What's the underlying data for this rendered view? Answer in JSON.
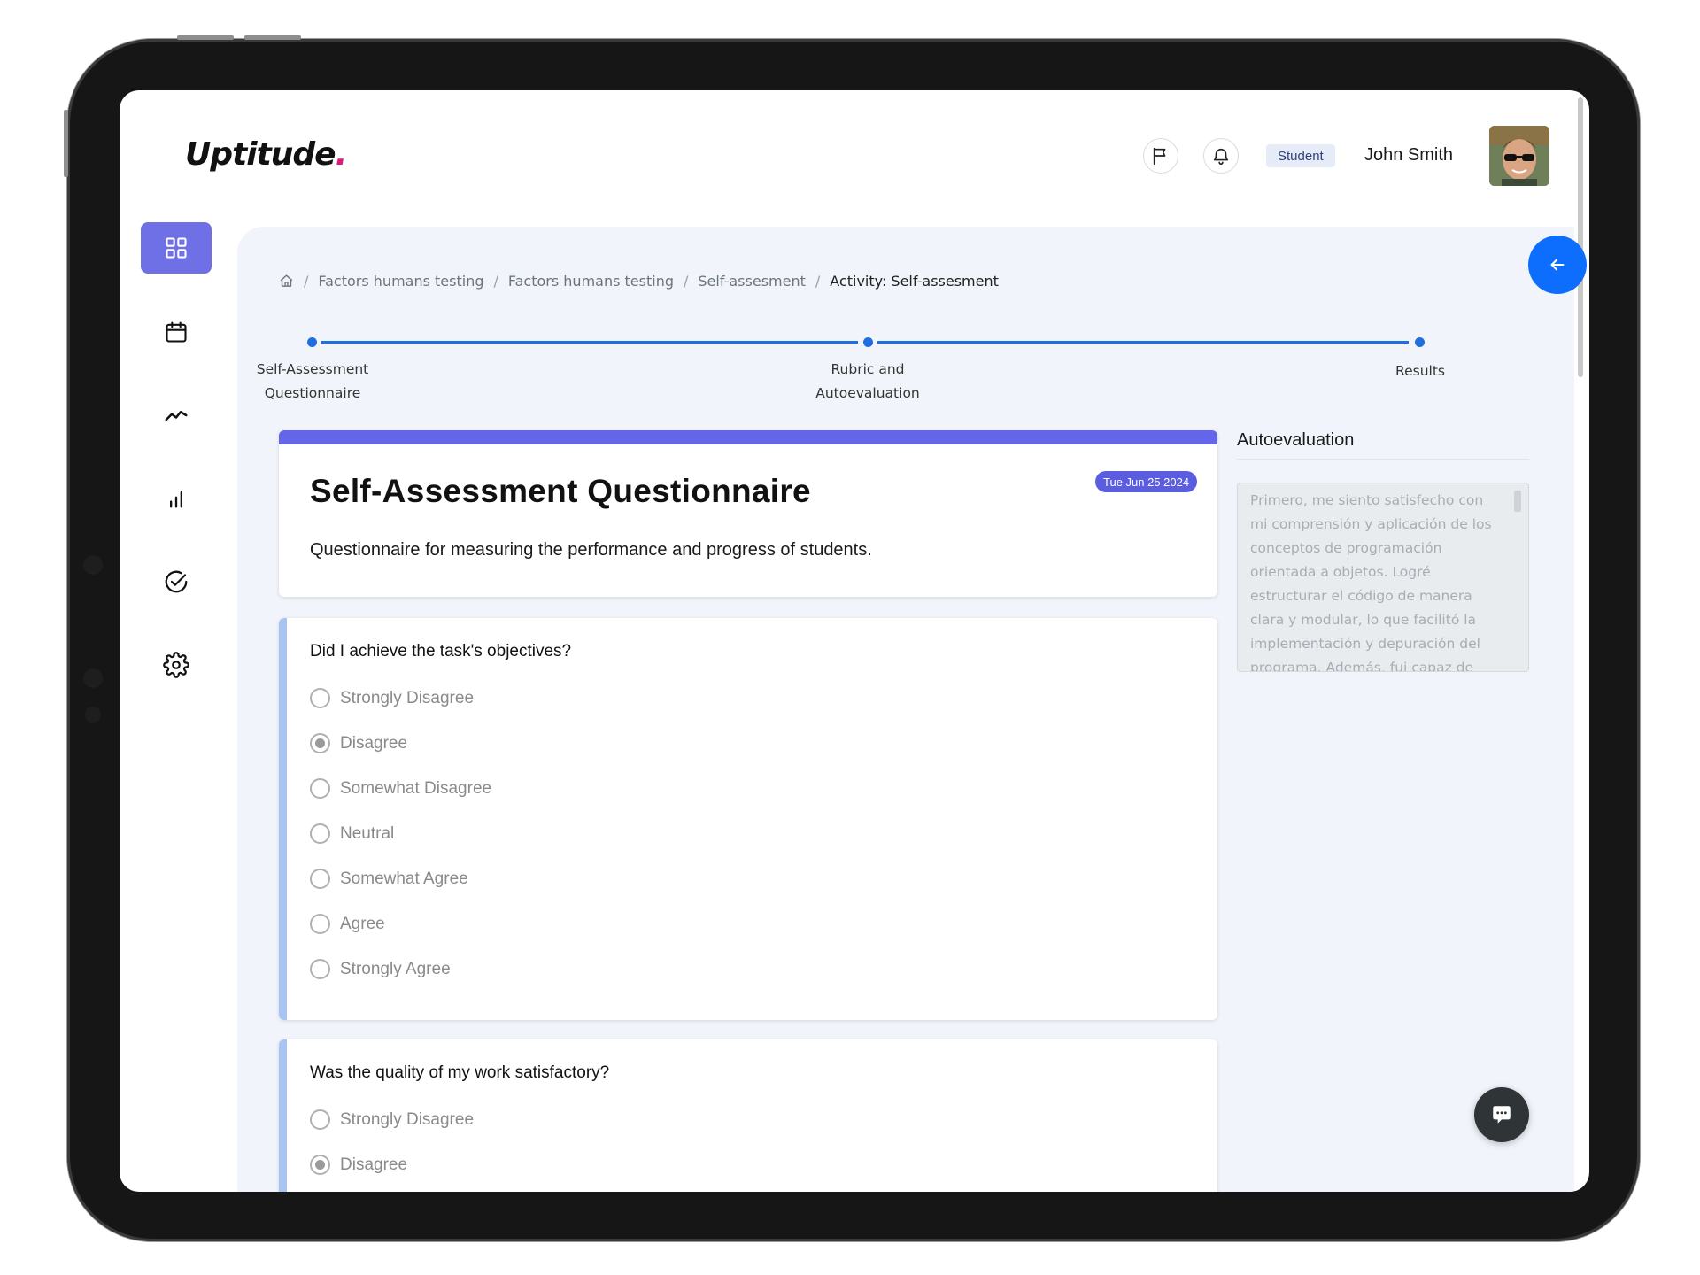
{
  "app": {
    "logo_text": "Uptitude",
    "logo_dot": "."
  },
  "header": {
    "role_badge": "Student",
    "user_name": "John Smith"
  },
  "sidebar": {
    "items": [
      {
        "icon": "grid-icon",
        "active": true
      },
      {
        "icon": "calendar-icon",
        "active": false
      },
      {
        "icon": "trend-icon",
        "active": false
      },
      {
        "icon": "bar-chart-icon",
        "active": false
      },
      {
        "icon": "check-circle-icon",
        "active": false
      },
      {
        "icon": "gear-icon",
        "active": false
      }
    ]
  },
  "breadcrumb": {
    "items": [
      "Factors humans testing",
      "Factors humans testing",
      "Self-assesment"
    ],
    "current": "Activity: Self-assesment"
  },
  "stepper": {
    "steps": [
      {
        "label_line1": "Self-Assessment",
        "label_line2": "Questionnaire"
      },
      {
        "label_line1": "Rubric and",
        "label_line2": "Autoevaluation"
      },
      {
        "label_line1": "Results",
        "label_line2": ""
      }
    ]
  },
  "questionnaire": {
    "title": "Self-Assessment Questionnaire",
    "date": "Tue Jun 25 2024",
    "description": "Questionnaire for measuring the performance and progress of students."
  },
  "questions": [
    {
      "text": "Did I achieve the task's objectives?",
      "options": [
        "Strongly Disagree",
        "Disagree",
        "Somewhat Disagree",
        "Neutral",
        "Somewhat Agree",
        "Agree",
        "Strongly Agree"
      ],
      "selected": "Disagree"
    },
    {
      "text": "Was the quality of my work satisfactory?",
      "options": [
        "Strongly Disagree",
        "Disagree"
      ],
      "selected": "Disagree"
    }
  ],
  "autoevaluation": {
    "title": "Autoevaluation",
    "text": "Primero, me siento satisfecho con mi comprensión y aplicación de los conceptos de programación orientada a objetos. Logré estructurar el código de manera clara y modular, lo que facilitó la implementación y depuración del programa. Además, fui capaz de"
  },
  "colors": {
    "accent": "#6466e8",
    "primary_blue": "#1f6fe0",
    "question_accent": "#a9c4f2",
    "logo_dot": "#e0187b"
  }
}
